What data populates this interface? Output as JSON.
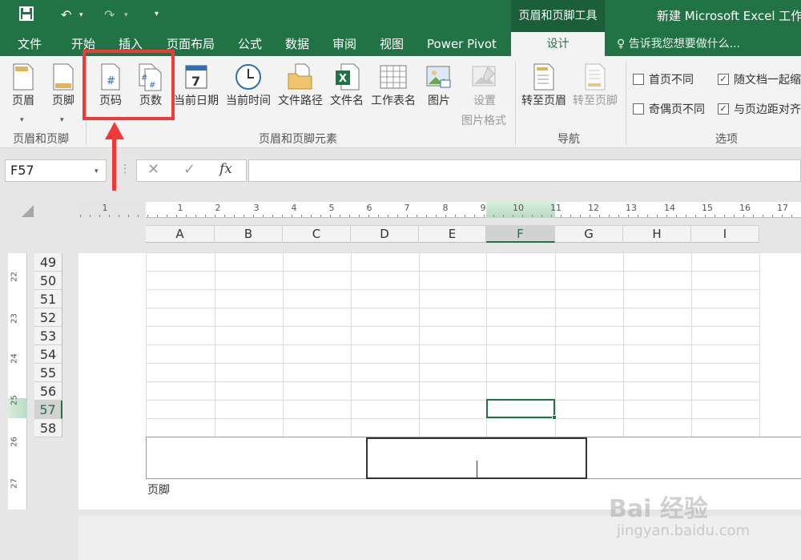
{
  "title_bar": {
    "contextual_tool": "页眉和页脚工具",
    "doc_title": "新建 Microsoft Excel 工作"
  },
  "tabs": [
    "文件",
    "开始",
    "插入",
    "页面布局",
    "公式",
    "数据",
    "审阅",
    "视图",
    "Power Pivot"
  ],
  "active_tab": "设计",
  "tell_me": "告诉我您想要做什么...",
  "ribbon": {
    "group1": {
      "label": "页眉和页脚",
      "buttons": [
        "页眉",
        "页脚"
      ]
    },
    "group2": {
      "label": "页眉和页脚元素",
      "buttons": [
        "页码",
        "页数",
        "当前日期",
        "当前时间",
        "文件路径",
        "文件名",
        "工作表名",
        "图片",
        "设置",
        "图片格式"
      ]
    },
    "group3": {
      "label": "导航",
      "buttons": [
        "转至页眉",
        "转至页脚"
      ]
    },
    "group4": {
      "label": "选项",
      "options": [
        {
          "label": "首页不同",
          "checked": false
        },
        {
          "label": "随文档一起缩",
          "checked": true
        },
        {
          "label": "奇偶页不同",
          "checked": false
        },
        {
          "label": "与页边距对齐",
          "checked": true
        }
      ]
    }
  },
  "formula_bar": {
    "name_box": "F57",
    "formula": ""
  },
  "ruler_ticks": [
    "1",
    "1",
    "2",
    "3",
    "4",
    "5",
    "6",
    "7",
    "8",
    "9",
    "10",
    "11",
    "12",
    "13",
    "14",
    "15",
    "16",
    "17"
  ],
  "vruler_ticks": [
    "22",
    "23",
    "24",
    "25",
    "26",
    "27"
  ],
  "columns": [
    "A",
    "B",
    "C",
    "D",
    "E",
    "F",
    "G",
    "H",
    "I"
  ],
  "rows": [
    "49",
    "50",
    "51",
    "52",
    "53",
    "54",
    "55",
    "56",
    "57",
    "58"
  ],
  "selected_cell": "F57",
  "footer_label": "页脚",
  "watermark": {
    "main": "Bai 经验",
    "sub": "jingyan.baidu.com"
  },
  "colors": {
    "excel_green": "#217346",
    "annotation_red": "#f33838"
  }
}
